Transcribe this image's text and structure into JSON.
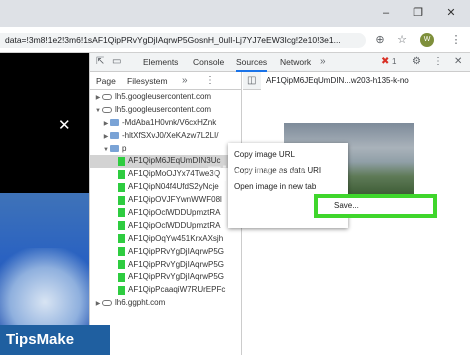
{
  "address_bar": {
    "url": "data=!3m8!1e2!3m6!1sAF1QipPRvYgDjIAqrwP5GosnH_0ulI-Lj7YJ7eEW3Icg!2e10!3e1..."
  },
  "devtools": {
    "main_tabs": [
      "Elements",
      "Console",
      "Sources",
      "Network"
    ],
    "active_tab": "Sources",
    "error_count": "1",
    "navigator_tabs": [
      "Page",
      "Filesystem"
    ],
    "tree": [
      {
        "label": "lh5.googleusercontent.com",
        "kind": "cloud",
        "indent": 1
      },
      {
        "label": "lh5.googleusercontent.com",
        "kind": "cloud",
        "indent": 1,
        "expanded": true
      },
      {
        "label": "-MdAba1H0vnk/V6cxHZnk",
        "kind": "folder",
        "indent": 2
      },
      {
        "label": "-hltXfSXvJ0/XeKAzw7L2LI/",
        "kind": "folder",
        "indent": 2
      },
      {
        "label": "p",
        "kind": "folder",
        "indent": 2,
        "expanded": true
      },
      {
        "label": "AF1QipM6JEqUmDIN3Uc",
        "kind": "file",
        "indent": 3,
        "selected": true
      },
      {
        "label": "AF1QipMoOJYx74Twe3Q",
        "kind": "file",
        "indent": 3
      },
      {
        "label": "AF1QipN04f4UfdS2yNcje",
        "kind": "file",
        "indent": 3
      },
      {
        "label": "AF1QipOVJFYwnWWF08l",
        "kind": "file",
        "indent": 3
      },
      {
        "label": "AF1QipOclWDDUpmztRA",
        "kind": "file",
        "indent": 3
      },
      {
        "label": "AF1QipOclWDDUpmztRA",
        "kind": "file",
        "indent": 3
      },
      {
        "label": "AF1QipOqYw451KrxAXsjh",
        "kind": "file",
        "indent": 3
      },
      {
        "label": "AF1QipPRvYgDjIAqrwP5G",
        "kind": "file",
        "indent": 3
      },
      {
        "label": "AF1QipPRvYgDjIAqrwP5G",
        "kind": "file",
        "indent": 3
      },
      {
        "label": "AF1QipPRvYgDjIAqrwP5G",
        "kind": "file",
        "indent": 3
      },
      {
        "label": "AF1QipPcaaqiW7RUrEPFc",
        "kind": "file",
        "indent": 3
      },
      {
        "label": "lh6.ggpht.com",
        "kind": "cloud",
        "indent": 1
      }
    ],
    "source_tab": "AF1QipM6JEqUmDIN...w203-h135-k-no"
  },
  "context_menu": {
    "items": [
      "Copy image URL",
      "Copy image as data URI",
      "Open image in new tab"
    ],
    "save": "Save..."
  },
  "watermark": "TipsMake",
  "brand": "TipsMake",
  "colors": {
    "highlight": "#3fd62c",
    "brand_bg": "#1f5fa0",
    "file_icon": "#2ecc40",
    "tab_underline": "#1a73e8"
  }
}
